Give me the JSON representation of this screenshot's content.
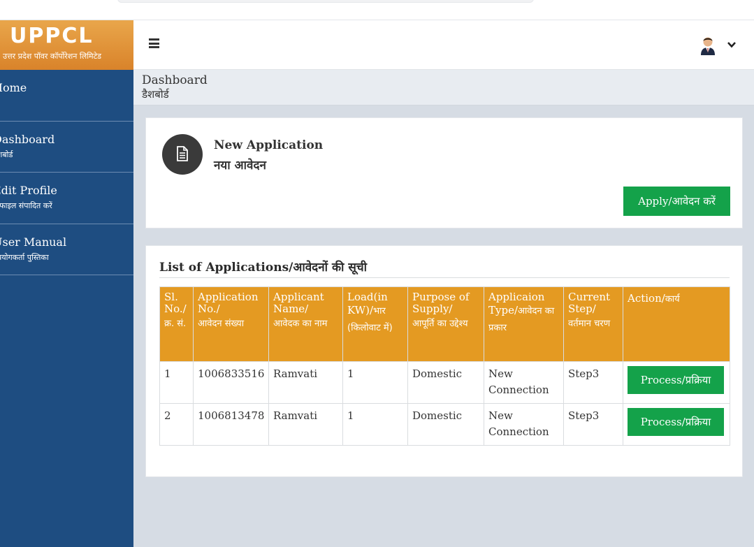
{
  "logo": {
    "brand": "UPPCL",
    "subtitle": "उत्तर प्रदेश पॉवर कॉर्पोरेशन लिमिटेड"
  },
  "header": {
    "menu_icon": "hamburger-icon",
    "avatar_icon": "user-avatar-icon",
    "dropdown_icon": "chevron-down-icon"
  },
  "sidebar": {
    "items": [
      {
        "label_en": "Home",
        "label_hi": ""
      },
      {
        "label_en": "Dashboard",
        "label_hi": "डैशबोर्ड"
      },
      {
        "label_en": "Edit Profile",
        "label_hi": "प्रोफाइल संपादित करें"
      },
      {
        "label_en": "User Manual",
        "label_hi": "उपयोगकर्ता पुस्तिका"
      }
    ]
  },
  "breadcrumb": {
    "title_en": "Dashboard",
    "title_hi": "डैशबोर्ड"
  },
  "new_application": {
    "icon": "document-icon",
    "title_en": "New Application",
    "title_hi": "नया आवेदन",
    "apply_label": "Apply/आवेदन करें"
  },
  "applications": {
    "title": "List of Applications/आवेदनों की सूची",
    "columns": [
      {
        "en": "Sl. No./",
        "hi": "क्र. सं."
      },
      {
        "en": "Application No./",
        "hi": "आवेदन संख्या"
      },
      {
        "en": "Applicant Name/",
        "hi": "आवेदक का नाम"
      },
      {
        "en": "Load(in KW)/",
        "hi": "भार (किलोवाट में)"
      },
      {
        "en": "Purpose of Supply/",
        "hi": "आपूर्ति का उद्देश्य"
      },
      {
        "en": "Applicaion Type/",
        "hi": "आवेदन का प्रकार"
      },
      {
        "en": "Current Step/",
        "hi": "वर्तमान चरण"
      },
      {
        "en": "Action/",
        "hi": "कार्य"
      }
    ],
    "rows": [
      {
        "sl": "1",
        "app_no": "1006833516",
        "name": "Ramvati",
        "load": "1",
        "purpose": "Domestic",
        "type": "New Connection",
        "step": "Step3",
        "action": "Process/प्रक्रिया"
      },
      {
        "sl": "2",
        "app_no": "1006813478",
        "name": "Ramvati",
        "load": "1",
        "purpose": "Domestic",
        "type": "New Connection",
        "step": "Step3",
        "action": "Process/प्रक्रिया"
      }
    ]
  },
  "colors": {
    "accent_orange": "#e49a22",
    "sidebar_blue": "#1e4d81",
    "button_green": "#14a24a"
  }
}
